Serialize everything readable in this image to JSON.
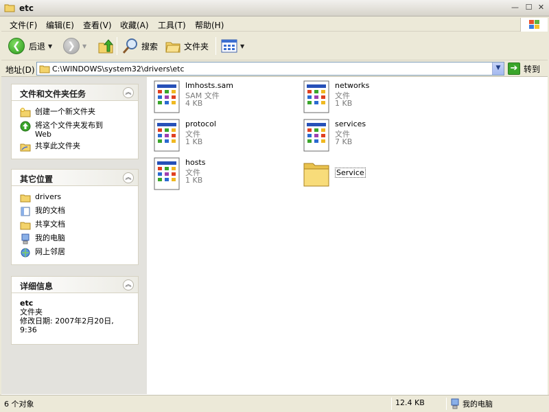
{
  "window": {
    "title": "etc",
    "min": "—",
    "max": "☐",
    "close": "✕"
  },
  "menu": [
    "文件(F)",
    "编辑(E)",
    "查看(V)",
    "收藏(A)",
    "工具(T)",
    "帮助(H)"
  ],
  "toolbar": {
    "back": "后退",
    "search": "搜索",
    "folders": "文件夹"
  },
  "address": {
    "label": "地址(D)",
    "value": "C:\\WINDOWS\\system32\\drivers\\etc",
    "go": "转到"
  },
  "tasks_panel": {
    "title": "文件和文件夹任务",
    "items": [
      "创建一个新文件夹",
      "将这个文件夹发布到 Web",
      "共享此文件夹"
    ]
  },
  "places_panel": {
    "title": "其它位置",
    "items": [
      "drivers",
      "我的文档",
      "共享文档",
      "我的电脑",
      "网上邻居"
    ]
  },
  "details_panel": {
    "title": "详细信息",
    "name": "etc",
    "type": "文件夹",
    "modified": "修改日期: 2007年2月20日, 9:36"
  },
  "files": [
    {
      "name": "lmhosts.sam",
      "type": "SAM 文件",
      "size": "4 KB",
      "icon": "document-icon"
    },
    {
      "name": "networks",
      "type": "文件",
      "size": "1 KB",
      "icon": "document-icon"
    },
    {
      "name": "protocol",
      "type": "文件",
      "size": "1 KB",
      "icon": "document-icon"
    },
    {
      "name": "services",
      "type": "文件",
      "size": "7 KB",
      "icon": "document-icon"
    },
    {
      "name": "hosts",
      "type": "文件",
      "size": "1 KB",
      "icon": "document-icon"
    },
    {
      "name": "Service",
      "type": "",
      "size": "",
      "icon": "folder-icon"
    }
  ],
  "status": {
    "objects": "6 个对象",
    "size": "12.4 KB",
    "location": "我的电脑"
  }
}
